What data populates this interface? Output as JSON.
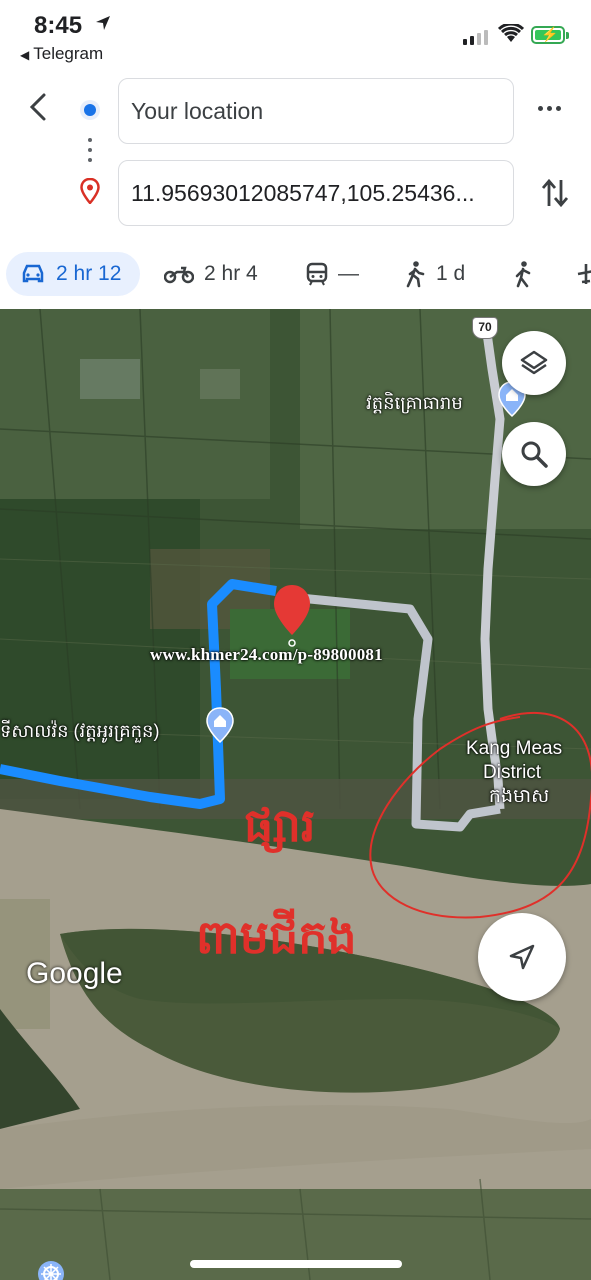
{
  "status_bar": {
    "time": "8:45",
    "back_app": "Telegram"
  },
  "directions": {
    "origin_text": "Your location",
    "destination_text": "11.95693012085747,105.25436..."
  },
  "modes": [
    {
      "icon": "car-icon",
      "label": "2 hr 12",
      "active": true
    },
    {
      "icon": "motorcycle-icon",
      "label": "2 hr 4",
      "active": false
    },
    {
      "icon": "transit-icon",
      "label": "—",
      "active": false
    },
    {
      "icon": "walk-icon",
      "label": "1 d",
      "active": false
    },
    {
      "icon": "ride-icon",
      "label": "",
      "active": false
    }
  ],
  "map": {
    "highway_shield": "70",
    "poi_temple_north": "វត្តនិគ្រោធារាម",
    "poi_temple_west": "ទីសាលវ៉ន (វត្តអូរគ្រកួន)",
    "district_label_1": "Kang Meas",
    "district_label_2": "District",
    "district_label_km": "កងមាស",
    "watermark": "www.khmer24.com/p-89800081",
    "handwritten_market": "ផ្សារ",
    "handwritten_island": "ពាមជីកង",
    "google_logo": "Google"
  },
  "colors": {
    "route_active": "#1a8cff",
    "route_alt": "#bfc4cc",
    "pin": "#e53935",
    "annotation": "#e0302a",
    "accent": "#1a73e8"
  }
}
